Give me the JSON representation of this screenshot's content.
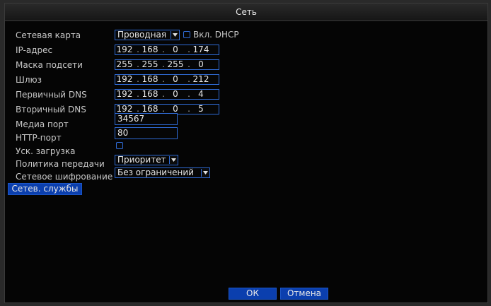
{
  "window": {
    "title": "Сеть"
  },
  "fields": {
    "network_card": {
      "label": "Сетевая карта",
      "value": "Проводная"
    },
    "dhcp": {
      "label": "Вкл. DHCP",
      "checked": false
    },
    "ip": {
      "label": "IP-адрес",
      "octets": [
        "192",
        "168",
        "0",
        "174"
      ]
    },
    "mask": {
      "label": "Маска подсети",
      "octets": [
        "255",
        "255",
        "255",
        "0"
      ]
    },
    "gateway": {
      "label": "Шлюз",
      "octets": [
        "192",
        "168",
        "0",
        "212"
      ]
    },
    "dns1": {
      "label": "Первичный DNS",
      "octets": [
        "192",
        "168",
        "0",
        "4"
      ]
    },
    "dns2": {
      "label": "Вторичный DNS",
      "octets": [
        "192",
        "168",
        "0",
        "5"
      ]
    },
    "media_port": {
      "label": "Медиа порт",
      "value": "34567"
    },
    "http_port": {
      "label": "HTTP-порт",
      "value": "80"
    },
    "fast_download": {
      "label": "Уск. загрузка",
      "checked": false
    },
    "transfer_policy": {
      "label": "Политика передачи",
      "value": "Приоритет к"
    },
    "encryption": {
      "label": "Сетевое шифрование",
      "value": "Без ограничений"
    }
  },
  "buttons": {
    "net_services": "Сетев. службы",
    "ok": "ОК",
    "cancel": "Отмена"
  },
  "colors": {
    "accent": "#2f6bd6",
    "button": "#0b3fae",
    "background": "#050505"
  }
}
